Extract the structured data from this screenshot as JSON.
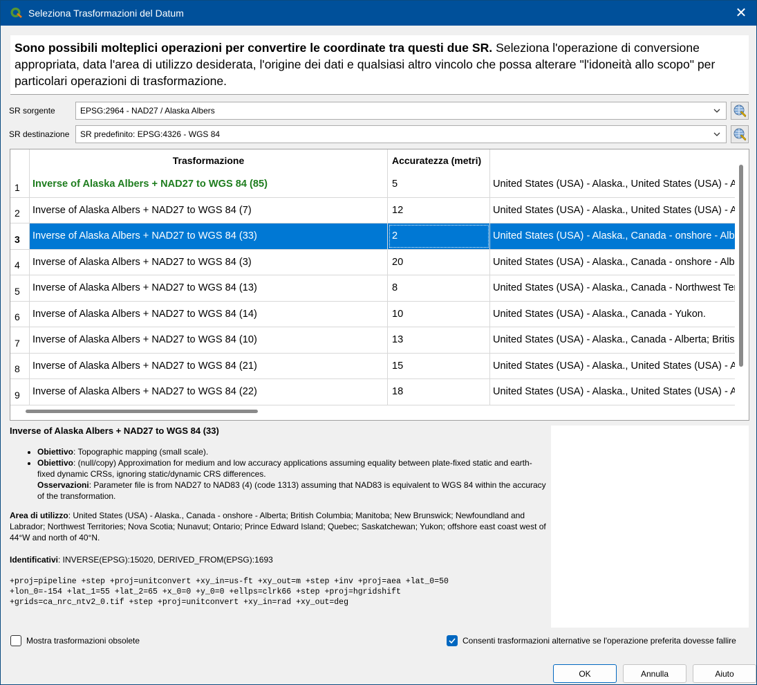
{
  "window": {
    "title": "Seleziona Trasformazioni del Datum",
    "close_glyph": "✕"
  },
  "intro": {
    "bold": "Sono possibili molteplici operazioni per convertire le coordinate tra questi due SR.",
    "text": " Seleziona l'operazione di conversione appropriata, data l'area di utilizzo desiderata, l'origine dei dati e qualsiasi altro vincolo che possa alterare \"l'idoneità allo scopo\" per particolari operazioni di trasformazione."
  },
  "source": {
    "label": "SR sorgente",
    "value": "EPSG:2964 - NAD27 / Alaska Albers"
  },
  "destination": {
    "label": "SR destinazione",
    "value": "SR predefinito: EPSG:4326 - WGS 84"
  },
  "table": {
    "headers": [
      "Trasformazione",
      "Accuratezza (metri)",
      ""
    ],
    "rows": [
      {
        "n": "1",
        "name": "Inverse of Alaska Albers + NAD27 to WGS 84 (85)",
        "acc": "5",
        "area": "United States (USA) - Alaska., United States (USA) - A"
      },
      {
        "n": "2",
        "name": "Inverse of Alaska Albers + NAD27 to WGS 84 (7)",
        "acc": "12",
        "area": "United States (USA) - Alaska., United States (USA) - A"
      },
      {
        "n": "3",
        "name": "Inverse of Alaska Albers + NAD27 to WGS 84 (33)",
        "acc": "2",
        "area": "United States (USA) - Alaska., Canada - onshore - Alb"
      },
      {
        "n": "4",
        "name": "Inverse of Alaska Albers + NAD27 to WGS 84 (3)",
        "acc": "20",
        "area": "United States (USA) - Alaska., Canada - onshore - Alb"
      },
      {
        "n": "5",
        "name": "Inverse of Alaska Albers + NAD27 to WGS 84 (13)",
        "acc": "8",
        "area": "United States (USA) - Alaska., Canada - Northwest Ter"
      },
      {
        "n": "6",
        "name": "Inverse of Alaska Albers + NAD27 to WGS 84 (14)",
        "acc": "10",
        "area": "United States (USA) - Alaska., Canada - Yukon."
      },
      {
        "n": "7",
        "name": "Inverse of Alaska Albers + NAD27 to WGS 84 (10)",
        "acc": "13",
        "area": "United States (USA) - Alaska., Canada - Alberta; Britisl"
      },
      {
        "n": "8",
        "name": "Inverse of Alaska Albers + NAD27 to WGS 84 (21)",
        "acc": "15",
        "area": "United States (USA) - Alaska., United States (USA) - A"
      },
      {
        "n": "9",
        "name": "Inverse of Alaska Albers + NAD27 to WGS 84 (22)",
        "acc": "18",
        "area": "United States (USA) - Alaska., United States (USA) - A"
      }
    ],
    "preferred_row": 0,
    "selected_row": 2
  },
  "details": {
    "name": "Inverse of Alaska Albers + NAD27 to WGS 84 (33)",
    "obj_label": "Obiettivo",
    "obj1": ": Topographic mapping (small scale).",
    "obj2": ": (null/copy) Approximation for medium and low accuracy applications assuming equality between plate-fixed static and earth-fixed dynamic CRSs, ignoring static/dynamic CRS differences.",
    "obs_label": "Osservazioni",
    "obs": ": Parameter file is from NAD27 to NAD83 (4) (code 1313) assuming that NAD83 is equivalent to WGS 84 within the accuracy of the transformation.",
    "area_label": "Area di utilizzo",
    "area": ": United States (USA) - Alaska., Canada - onshore - Alberta; British Columbia; Manitoba; New Brunswick; Newfoundland and Labrador; Northwest Territories; Nova Scotia; Nunavut; Ontario; Prince Edward Island; Quebec; Saskatchewan; Yukon; offshore east coast west of 44°W and north of 40°N.",
    "ids_label": "Identificativi",
    "ids": ": INVERSE(EPSG):15020, DERIVED_FROM(EPSG):1693",
    "proj": "+proj=pipeline +step +proj=unitconvert +xy_in=us-ft +xy_out=m +step +inv +proj=aea +lat_0=50\n+lon_0=-154 +lat_1=55 +lat_2=65 +x_0=0 +y_0=0 +ellps=clrk66 +step +proj=hgridshift\n+grids=ca_nrc_ntv2_0.tif +step +proj=unitconvert +xy_in=rad +xy_out=deg"
  },
  "options": {
    "show_obsolete": "Mostra trasformazioni obsolete",
    "show_obsolete_checked": false,
    "allow_fallback": "Consenti trasformazioni alternative se l'operazione preferita dovesse fallire",
    "allow_fallback_checked": true
  },
  "buttons": {
    "ok": "OK",
    "cancel": "Annulla",
    "help": "Aiuto"
  },
  "icons": {
    "app": "qgis-icon",
    "crs_select": "globe-icon",
    "combo": "chevron-down-icon",
    "close": "close-icon"
  },
  "colors": {
    "titlebar": "#00509a",
    "selection": "#0078d4",
    "preferred": "#1e7d1e",
    "checkbox": "#0067c0"
  }
}
